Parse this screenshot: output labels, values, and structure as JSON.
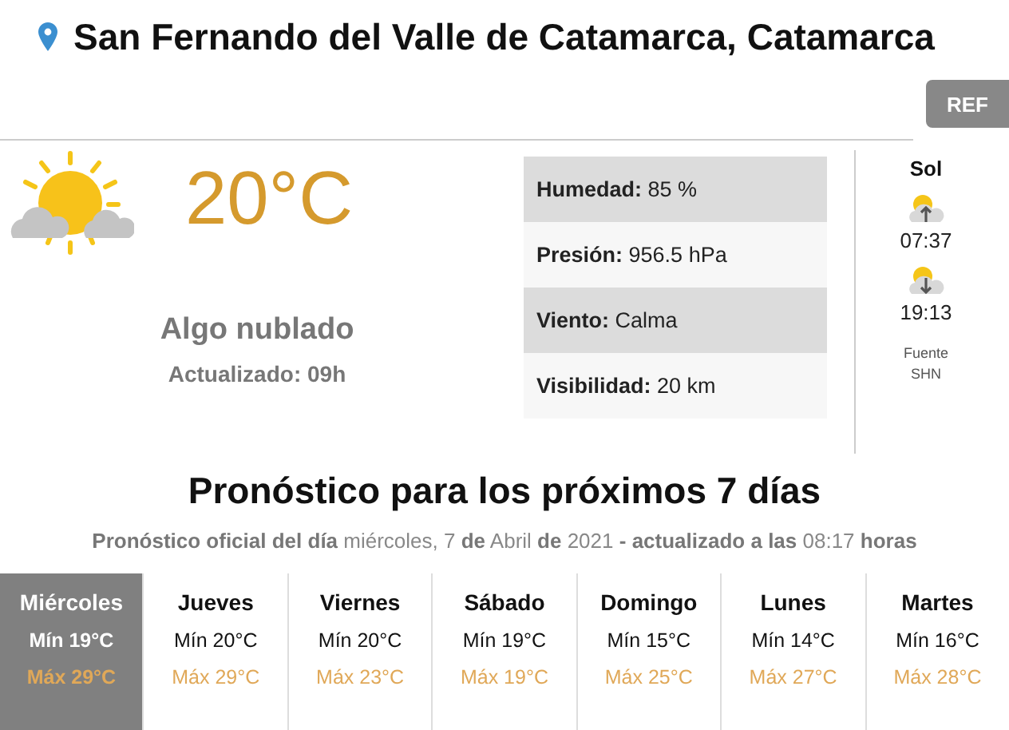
{
  "location": {
    "title": "San Fernando del Valle de Catamarca, Catamarca"
  },
  "ref_button": "REF",
  "current": {
    "temperature": "20°C",
    "condition": "Algo nublado",
    "updated": "Actualizado: 09h"
  },
  "details": [
    {
      "label": "Humedad:",
      "value": "85 %"
    },
    {
      "label": "Presión:",
      "value": "956.5 hPa"
    },
    {
      "label": "Viento:",
      "value": "Calma"
    },
    {
      "label": "Visibilidad:",
      "value": "20 km"
    }
  ],
  "sun": {
    "title": "Sol",
    "sunrise": "07:37",
    "sunset": "19:13",
    "source": "Fuente",
    "source_name": "SHN"
  },
  "forecast": {
    "title": "Pronóstico para los próximos 7 días",
    "subtitle": "**Pronóstico oficial del día** miércoles, 7 **de** Abril **de** 2021 **- actualizado a las** 08:17 **horas**",
    "days": [
      {
        "name": "Miércoles",
        "min": "Mín 19°C",
        "max": "Máx 29°C",
        "selected": true
      },
      {
        "name": "Jueves",
        "min": "Mín 20°C",
        "max": "Máx 29°C",
        "selected": false
      },
      {
        "name": "Viernes",
        "min": "Mín 20°C",
        "max": "Máx 23°C",
        "selected": false
      },
      {
        "name": "Sábado",
        "min": "Mín 19°C",
        "max": "Máx 19°C",
        "selected": false
      },
      {
        "name": "Domingo",
        "min": "Mín 15°C",
        "max": "Máx 25°C",
        "selected": false
      },
      {
        "name": "Lunes",
        "min": "Mín 14°C",
        "max": "Máx 27°C",
        "selected": false
      },
      {
        "name": "Martes",
        "min": "Mín 16°C",
        "max": "Máx 28°C",
        "selected": false
      }
    ]
  }
}
